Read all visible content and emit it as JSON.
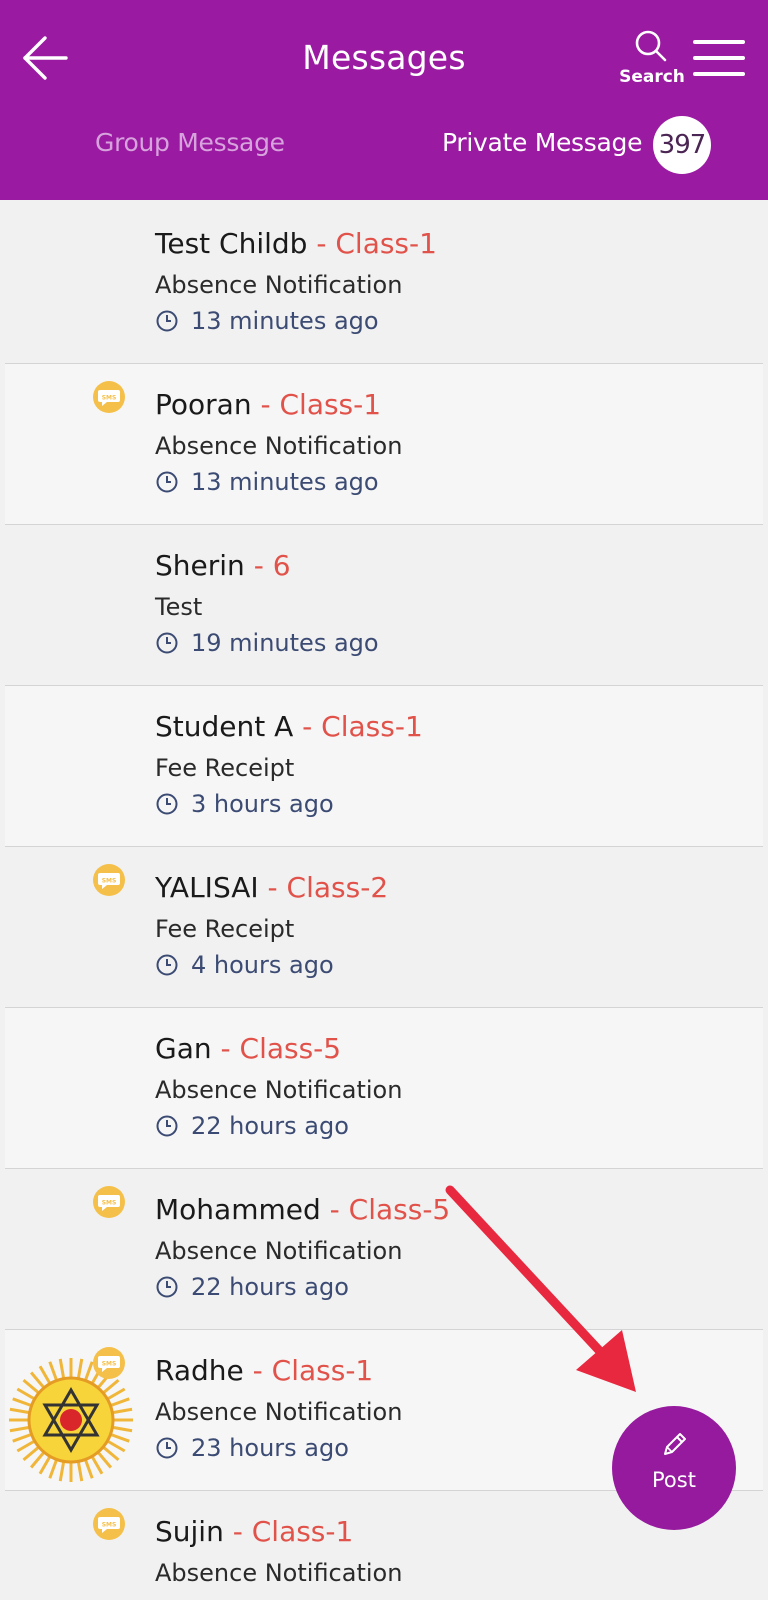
{
  "header": {
    "title": "Messages",
    "search_label": "Search",
    "tabs": [
      {
        "label": "Group Message",
        "active": false
      },
      {
        "label": "Private Message",
        "active": true,
        "badge": "397"
      }
    ],
    "color": "#9b1aa2"
  },
  "messages": [
    {
      "name": "Test Childb",
      "class": " - Class-1",
      "subject": "Absence Notification",
      "time": "13 minutes ago",
      "sms": false
    },
    {
      "name": "Pooran",
      "class": " - Class-1",
      "subject": "Absence Notification",
      "time": "13 minutes ago",
      "sms": true
    },
    {
      "name": "Sherin",
      "class": " - 6",
      "subject": "Test",
      "time": "19 minutes ago",
      "sms": false
    },
    {
      "name": "Student A",
      "class": " - Class-1",
      "subject": "Fee Receipt",
      "time": "3 hours ago",
      "sms": false
    },
    {
      "name": "YALISAI",
      "class": " - Class-2",
      "subject": "Fee Receipt",
      "time": "4 hours ago",
      "sms": true
    },
    {
      "name": "Gan",
      "class": " - Class-5",
      "subject": "Absence Notification",
      "time": "22 hours ago",
      "sms": false
    },
    {
      "name": "Mohammed",
      "class": " - Class-5",
      "subject": "Absence Notification",
      "time": "22 hours ago",
      "sms": true
    },
    {
      "name": "Radhe",
      "class": " - Class-1",
      "subject": "Absence Notification",
      "time": "23 hours ago",
      "sms": true,
      "avatar": "om-star-logo"
    },
    {
      "name": "Sujin",
      "class": " - Class-1",
      "subject": "Absence Notification",
      "time": "",
      "sms": true
    }
  ],
  "sms_icon_text": "SMS",
  "fab": {
    "label": "Post",
    "icon": "pencil-icon",
    "color": "#961a9e"
  },
  "annotation": {
    "icon": "red-arrow-icon",
    "color": "#e8283f"
  },
  "colors": {
    "class_label": "#e1524a",
    "time_text": "#3c4b73",
    "sms_badge": "#f5c04a"
  }
}
